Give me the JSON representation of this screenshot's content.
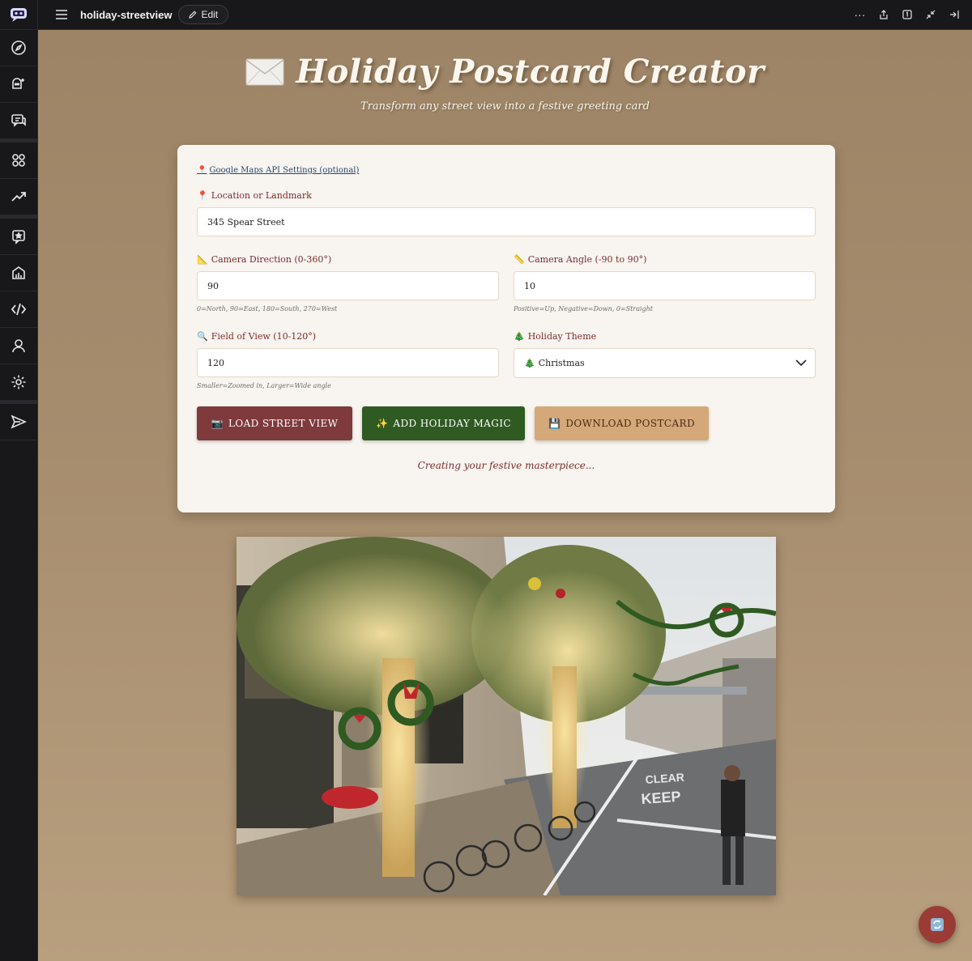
{
  "topbar": {
    "app_name": "holiday-streetview",
    "edit_label": "Edit",
    "more_label": "···"
  },
  "header": {
    "title": "Holiday Postcard Creator",
    "subtitle": "Transform any street view into a festive greeting card"
  },
  "form": {
    "api_settings_link": "Google Maps API Settings (optional)",
    "location": {
      "label": "Location or Landmark",
      "value": "345 Spear Street"
    },
    "direction": {
      "label": "Camera Direction (0-360°)",
      "value": "90",
      "hint": "0=North, 90=East, 180=South, 270=West"
    },
    "angle": {
      "label": "Camera Angle (-90 to 90°)",
      "value": "10",
      "hint": "Positive=Up, Negative=Down, 0=Straight"
    },
    "fov": {
      "label": "Field of View (10-120°)",
      "value": "120",
      "hint": "Smaller=Zoomed in, Larger=Wide angle"
    },
    "theme": {
      "label": "Holiday Theme",
      "selected": "Christmas"
    }
  },
  "buttons": {
    "load": "LOAD STREET VIEW",
    "magic": "ADD HOLIDAY MAGIC",
    "download": "DOWNLOAD POSTCARD"
  },
  "status_text": "Creating your festive masterpiece...",
  "icons": {
    "sidebar": [
      "app-logo-icon",
      "compass-icon",
      "bot-add-icon",
      "chat-icon",
      "apps-icon",
      "trending-icon",
      "star-message-icon",
      "analytics-icon",
      "code-icon",
      "user-icon",
      "settings-icon",
      "send-icon"
    ],
    "topbar": [
      "hamburger-menu-icon",
      "pencil-icon",
      "more-icon",
      "share-icon",
      "badge-one-icon",
      "collapse-icon",
      "expand-right-icon"
    ],
    "form": [
      "pin-icon",
      "triangle-ruler-icon",
      "straight-ruler-icon",
      "magnifier-icon",
      "tree-icon",
      "camera-icon",
      "sparkles-icon",
      "floppy-disk-icon"
    ]
  },
  "colors": {
    "background": "#a68d6e",
    "card": "#f8f4ef",
    "label": "#7a2e2e",
    "load_button": "#7e3a3c",
    "magic_button": "#2f5a22",
    "download_button": "#d4a878",
    "fab": "#9b3b36"
  }
}
